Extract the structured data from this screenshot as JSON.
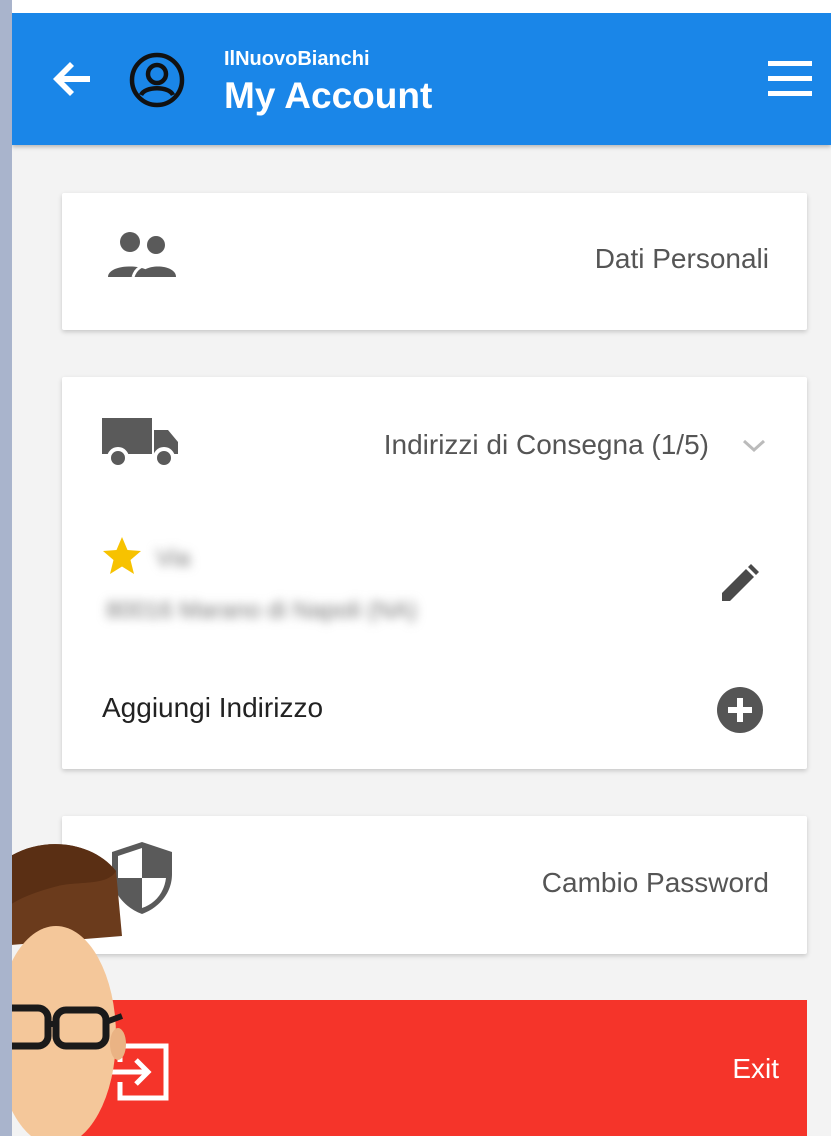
{
  "header": {
    "subtitle": "IlNuovoBianchi",
    "title": "My Account",
    "back_icon": "arrow-left-icon",
    "account_icon": "account-circle-icon",
    "menu_icon": "hamburger-menu-icon",
    "background_color": "#1a86e8"
  },
  "cards": {
    "personal": {
      "label": "Dati Personali",
      "icon": "people-icon"
    },
    "addresses": {
      "label": "Indirizzi di Consegna (1/5)",
      "icon": "truck-icon",
      "expand_icon": "chevron-down-icon",
      "default_icon": "star-icon",
      "address_line1": "Via",
      "address_line2": "80016 Marano di Napoli (NA)",
      "edit_icon": "pencil-icon",
      "add_label": "Aggiungi Indirizzo",
      "add_icon": "plus-circle-icon"
    },
    "password": {
      "label": "Cambio Password",
      "icon": "shield-icon"
    }
  },
  "exit": {
    "label": "Exit",
    "icon": "exit-icon",
    "background_color": "#f5342a"
  },
  "accent_colors": {
    "star": "#f7c200",
    "icon_gray": "#5a5a5a"
  }
}
